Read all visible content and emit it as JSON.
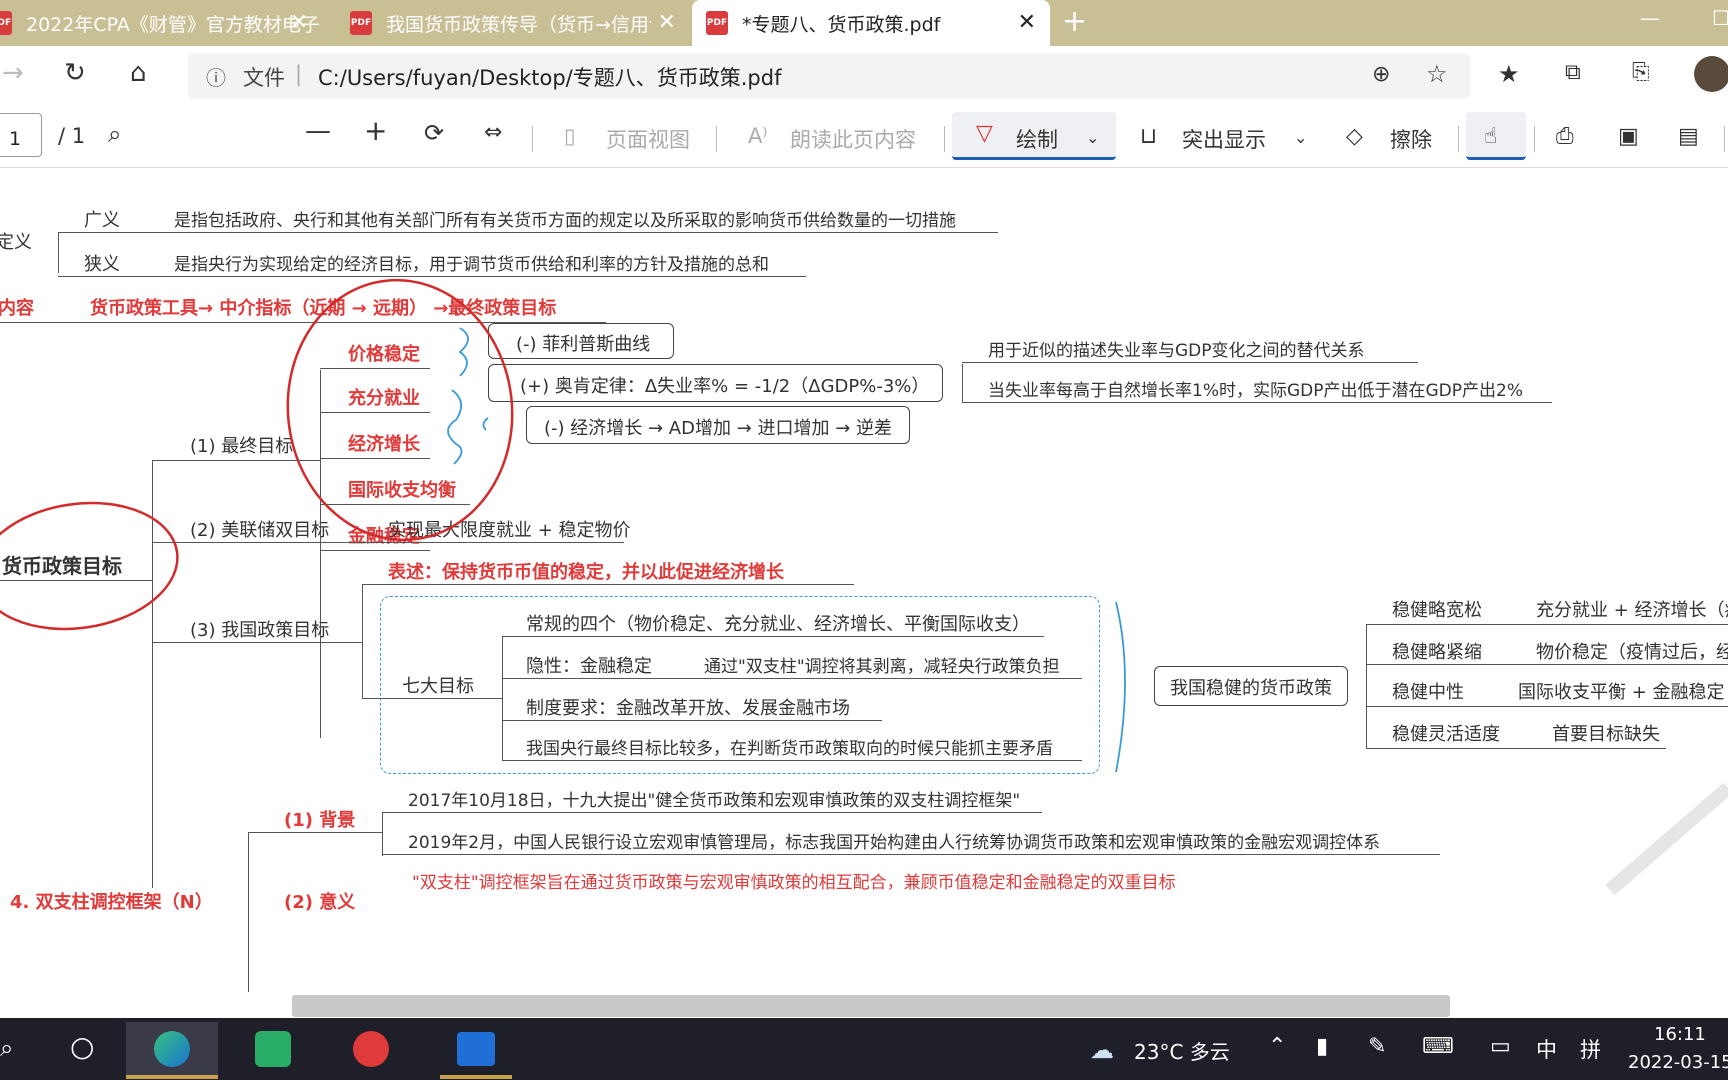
{
  "tabs": [
    {
      "label": "2022年CPA《财管》官方教材电子"
    },
    {
      "label": "我国货币政策传导（货币→信用创"
    },
    {
      "label": "*专题八、货币政策.pdf"
    }
  ],
  "address": {
    "file_label": "文件",
    "url": "C:/Users/fuyan/Desktop/专题八、货币政策.pdf"
  },
  "toolbar": {
    "page_current": "1",
    "page_total": "/ 1",
    "page_view": "页面视图",
    "read_aloud": "朗读此页内容",
    "draw": "绘制",
    "highlight": "突出显示",
    "erase": "擦除"
  },
  "doc": {
    "def_label": "定义",
    "broad": "广义",
    "broad_text": "是指包括政府、央行和其他有关部门所有有关货币方面的规定以及所采取的影响货币供给数量的一切措施",
    "narrow": "狭义",
    "narrow_text": "是指央行为实现给定的经济目标，用于调节货币供给和利率的方针及措施的总和",
    "content_label": "内容",
    "content_text": "货币政策工具→ 中介指标（近期 → 远期） →最终政策目标",
    "goals": [
      "价格稳定",
      "充分就业",
      "经济增长",
      "国际收支均衡",
      "金融稳定"
    ],
    "phillips": "(-) 菲利普斯曲线",
    "okun": "(+) 奥肯定律：Δ失业率% = -1/2（ΔGDP%-3%）",
    "trade": "(-) 经济增长 → AD增加 → 进口增加 → 逆差",
    "okun_note1": "用于近似的描述失业率与GDP变化之间的替代关系",
    "okun_note2": "当失业率每高于自然增长率1%时，实际GDP产出低于潜在GDP产出2%",
    "main_node": "货币政策目标",
    "final_goal": "(1) 最终目标",
    "fed_goal": "(2) 美联储双目标",
    "fed_text": "实现最大限度就业 + 稳定物价",
    "cn_goal": "(3) 我国政策目标",
    "cn_statement": "表述：保持货币币值的稳定，并以此促进经济增长",
    "seven": "七大目标",
    "seven_items": [
      "常规的四个（物价稳定、充分就业、经济增长、平衡国际收支）",
      "隐性：金融稳定",
      "制度要求：金融改革开放、发展金融市场",
      "我国央行最终目标比较多，在判断货币政策取向的时候只能抓主要矛盾"
    ],
    "twin_note": "通过\"双支柱\"调控将其剥离，减轻央行政策负担",
    "steady": "我国稳健的货币政策",
    "steady_items": [
      {
        "k": "稳健略宽松",
        "v": "充分就业 + 经济增长（疫"
      },
      {
        "k": "稳健略紧缩",
        "v": "物价稳定（疫情过后，经"
      },
      {
        "k": "稳健中性",
        "v": "国际收支平衡 + 金融稳定"
      },
      {
        "k": "稳健灵活适度",
        "v": "首要目标缺失"
      }
    ],
    "bg_label": "(1) 背景",
    "bg1": "2017年10月18日，十九大提出\"健全货币政策和宏观审慎政策的双支柱调控框架\"",
    "bg2": "2019年2月，中国人民银行设立宏观审慎管理局，标志我国开始构建由人行统筹协调货币政策和宏观审慎政策的金融宏观调控体系",
    "framework": "4. 双支柱调控框架（N）",
    "meaning_label": "(2) 意义",
    "meaning_text": "\"双支柱\"调控框架旨在通过货币政策与宏观审慎政策的相互配合，兼顾币值稳定和金融稳定的双重目标"
  },
  "taskbar": {
    "weather": "23°C 多云",
    "time": "16:11",
    "date": "2022-03-15",
    "ime1": "中",
    "ime2": "拼"
  }
}
